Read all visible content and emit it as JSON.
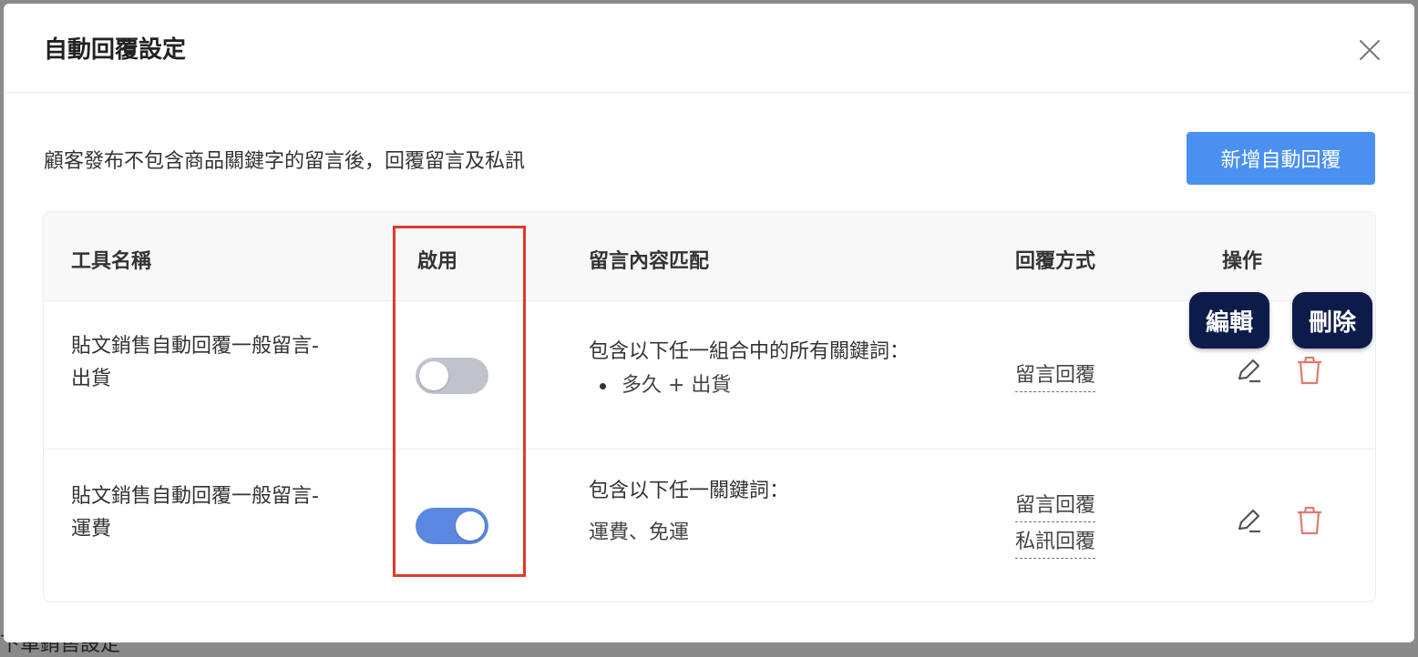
{
  "backdrop": {
    "text": "下單銷售設定"
  },
  "modal": {
    "title": "自動回覆設定",
    "description": "顧客發布不包含商品關鍵字的留言後，回覆留言及私訊",
    "add_button_label": "新增自動回覆"
  },
  "table": {
    "headers": {
      "name": "工具名稱",
      "enabled": "啟用",
      "match": "留言內容匹配",
      "reply": "回覆方式",
      "actions": "操作"
    },
    "rows": [
      {
        "name_line1": "貼文銷售自動回覆一般留言-",
        "name_line2": "出貨",
        "enabled": false,
        "match_title": "包含以下任一組合中的所有關鍵詞：",
        "match_items": [
          "多久 + 出貨"
        ],
        "reply_types": [
          "留言回覆"
        ]
      },
      {
        "name_line1": "貼文銷售自動回覆一般留言-",
        "name_line2": "運費",
        "enabled": true,
        "match_title": "包含以下任一關鍵詞：",
        "match_text": "運費、免運",
        "reply_types": [
          "留言回覆",
          "私訊回覆"
        ]
      }
    ]
  },
  "tooltips": {
    "edit": "編輯",
    "delete": "刪除"
  },
  "colors": {
    "primary": "#4a90f0",
    "toggle_on": "#5a87e0",
    "toggle_off": "#bfc4cc",
    "delete_icon": "#e07a6e",
    "highlight": "#e03a2c",
    "tooltip_bg": "#0d1b4a"
  },
  "icons": {
    "close": "close-icon",
    "edit": "pencil-icon",
    "delete": "trash-icon"
  }
}
